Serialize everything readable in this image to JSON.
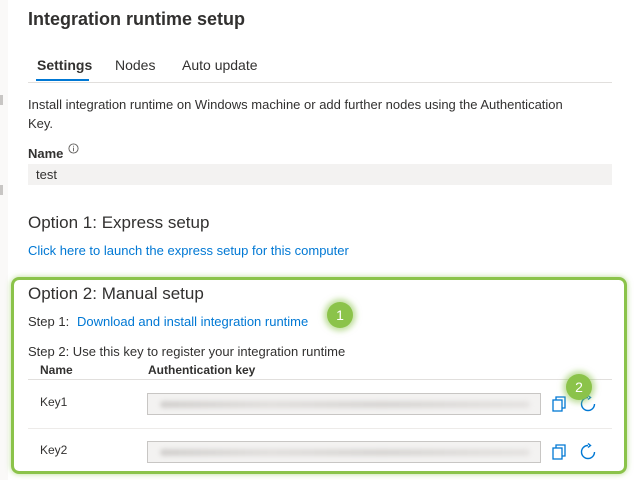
{
  "header": {
    "title": "Integration runtime setup"
  },
  "tabs": [
    {
      "label": "Settings",
      "active": true
    },
    {
      "label": "Nodes",
      "active": false
    },
    {
      "label": "Auto update",
      "active": false
    }
  ],
  "description": "Install integration runtime on Windows machine or add further nodes using the Authentication Key.",
  "name_field": {
    "label": "Name",
    "value": "test",
    "icon": "info-icon"
  },
  "option1": {
    "title": "Option 1: Express setup",
    "link": "Click here to launch the express setup for this computer"
  },
  "option2": {
    "title": "Option 2: Manual setup",
    "step1_label": "Step 1:",
    "step1_link": "Download and install integration runtime",
    "step2_label": "Step 2: Use this key to register your integration runtime",
    "table": {
      "headers": {
        "name": "Name",
        "key": "Authentication key"
      },
      "rows": [
        {
          "name": "Key1",
          "key_obscured": true
        },
        {
          "name": "Key2",
          "key_obscured": true
        }
      ]
    }
  },
  "callouts": [
    {
      "label": "1"
    },
    {
      "label": "2"
    }
  ],
  "colors": {
    "accent": "#0078d4",
    "highlight": "#8bc34a",
    "text": "#323130",
    "field_bg": "#f3f2f1"
  }
}
